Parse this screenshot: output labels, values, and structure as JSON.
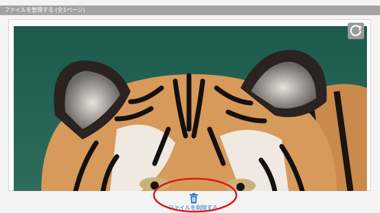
{
  "header": {
    "title": "ファイルを管理する (全1ページ)"
  },
  "viewer": {
    "image_subject": "tiger",
    "rotate_icon": "rotate-icon"
  },
  "footer": {
    "delete_label": "ファイルを削除する",
    "delete_icon": "trash-icon",
    "accent_color": "#1a73c9",
    "highlight_color": "#e0141b"
  }
}
